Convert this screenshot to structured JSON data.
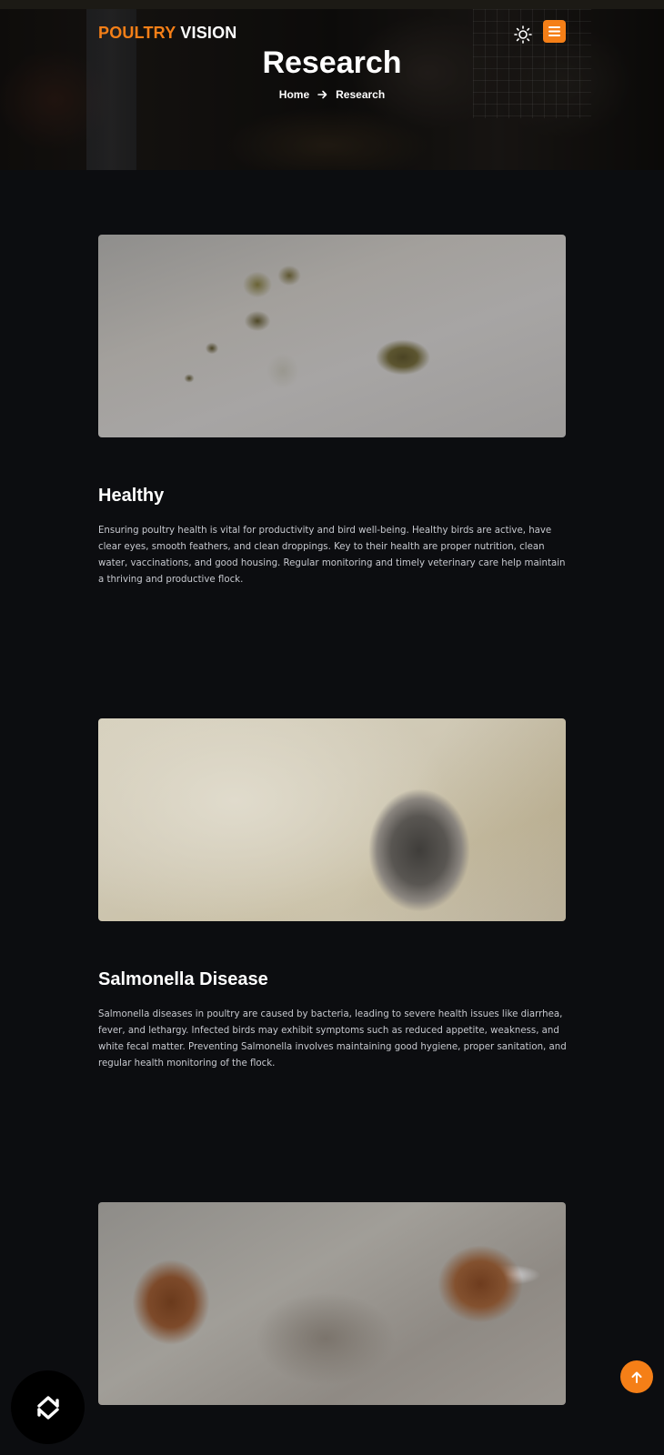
{
  "header": {
    "logo_part1": "POULTRY",
    "logo_part2": "VISION",
    "theme_icon": "sun-icon",
    "menu_icon": "hamburger-menu-icon",
    "accent_color": "#f57f17"
  },
  "hero": {
    "title": "Research",
    "breadcrumb": {
      "home": "Home",
      "separator_icon": "arrow-right-icon",
      "current": "Research"
    }
  },
  "articles": [
    {
      "title": "Healthy",
      "body": "Ensuring poultry health is vital for productivity and bird well-being. Healthy birds are active, have clear eyes, smooth feathers, and clean droppings. Key to their health are proper nutrition, clean water, vaccinations, and good housing. Regular monitoring and timely veterinary care help maintain a thriving and productive flock."
    },
    {
      "title": "Salmonella Disease",
      "body": "Salmonella diseases in poultry are caused by bacteria, leading to severe health issues like diarrhea, fever, and lethargy. Infected birds may exhibit symptoms such as reduced appetite, weakness, and white fecal matter. Preventing Salmonella involves maintaining good hygiene, proper sanitation, and regular health monitoring of the flock."
    },
    {
      "title": "",
      "body": ""
    }
  ],
  "floating": {
    "refresh_icon": "refresh-icon",
    "scroll_top_icon": "arrow-up-icon"
  }
}
